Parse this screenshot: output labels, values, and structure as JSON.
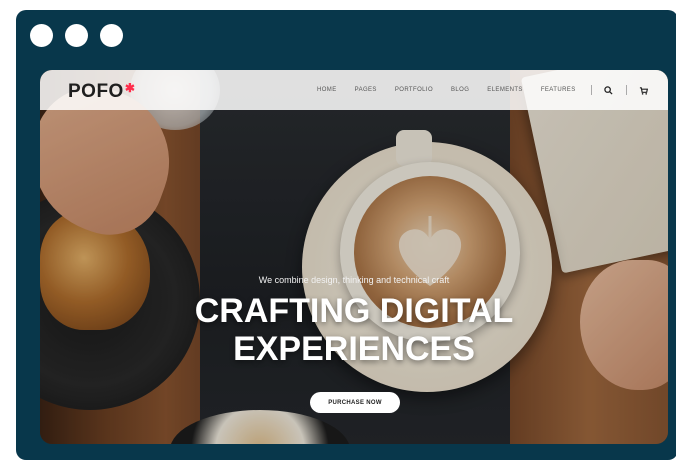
{
  "window": {
    "controls": [
      "dot",
      "dot",
      "dot"
    ]
  },
  "navbar": {
    "logo": "POFO",
    "logo_mark": "✱",
    "items": [
      {
        "label": "Home"
      },
      {
        "label": "Pages"
      },
      {
        "label": "Portfolio"
      },
      {
        "label": "Blog"
      },
      {
        "label": "Elements"
      },
      {
        "label": "Features"
      }
    ],
    "icons": [
      "search-icon",
      "cart-icon"
    ]
  },
  "hero": {
    "tagline": "We combine design, thinking and technical craft",
    "headline_line1": "CRAFTING DIGITAL",
    "headline_line2": "EXPERIENCES",
    "cta_label": "PURCHASE NOW"
  },
  "colors": {
    "frame": "#08374b",
    "accent": "#ff2d4b",
    "cta_bg": "#ffffff"
  }
}
